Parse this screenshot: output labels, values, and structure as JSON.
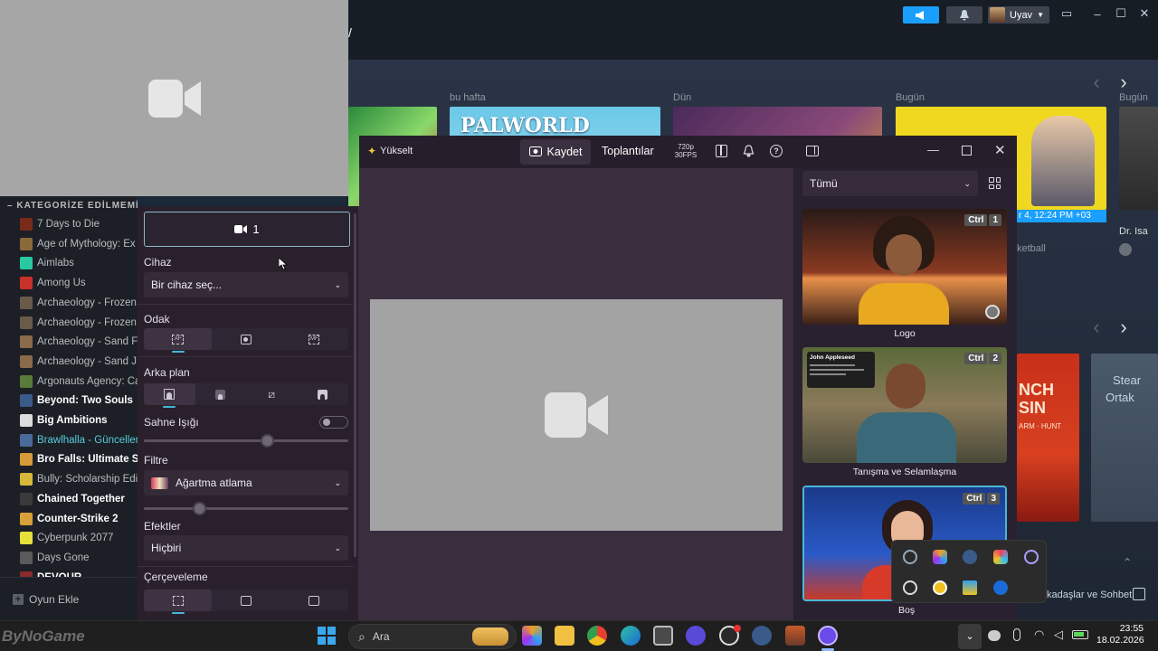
{
  "steam": {
    "announce_icon": "megaphone-icon",
    "notif_icon": "bell-icon",
    "user_name": "Uyav",
    "day_labels": [
      "bu hafta",
      "Dün",
      "Bugün",
      "Bugün"
    ],
    "card_palworld_text": "PALWORLD",
    "card_date_text": "r 4, 12:24 PM +03",
    "card_basketball_text": "ketball",
    "card_dr_text": "Dr. Isa",
    "card_punchsin_text": "NCH",
    "card_punchsin_sub": "SIN",
    "card_farm_text": "ARM · HUNT",
    "card_steam_text": "Stear",
    "card_steam_text2": "Ortak",
    "friends_chat": "kadaşlar ve Sohbet",
    "add_game": "Oyun Ekle",
    "category_title": "KATEGORİZE EDİLMEMİŞ",
    "games": [
      {
        "name": "7 Days to Die",
        "style": "normal",
        "color": "#7a2a1a"
      },
      {
        "name": "Age of Mythology: Ex",
        "style": "normal",
        "color": "#8a6a3a"
      },
      {
        "name": "Aimlabs",
        "style": "normal",
        "color": "#28c8a0"
      },
      {
        "name": "Among Us",
        "style": "normal",
        "color": "#c8302a"
      },
      {
        "name": "Archaeology - Frozen",
        "style": "normal",
        "color": "#6a5a4a"
      },
      {
        "name": "Archaeology - Frozen",
        "style": "normal",
        "color": "#6a5a4a"
      },
      {
        "name": "Archaeology - Sand F",
        "style": "normal",
        "color": "#8a6a4a"
      },
      {
        "name": "Archaeology - Sand J",
        "style": "normal",
        "color": "#8a6a4a"
      },
      {
        "name": "Argonauts Agency: Ca",
        "style": "normal",
        "color": "#5a7a3a"
      },
      {
        "name": "Beyond: Two Souls",
        "style": "bold",
        "color": "#3a5a8a"
      },
      {
        "name": "Big Ambitions",
        "style": "bold",
        "color": "#dcdcdc"
      },
      {
        "name": "Brawlhalla - Güncellen",
        "style": "update",
        "color": "#4a6a9a"
      },
      {
        "name": "Bro Falls: Ultimate Sh",
        "style": "bold",
        "color": "#d89a3a"
      },
      {
        "name": "Bully: Scholarship Edi",
        "style": "normal",
        "color": "#d8b83a"
      },
      {
        "name": "Chained Together",
        "style": "bold",
        "color": "#3a3a3a"
      },
      {
        "name": "Counter-Strike 2",
        "style": "bold",
        "color": "#d8a03a"
      },
      {
        "name": "Cyberpunk 2077",
        "style": "normal",
        "color": "#e8e03a"
      },
      {
        "name": "Days Gone",
        "style": "normal",
        "color": "#5a5a5a"
      },
      {
        "name": "DEVOUR",
        "style": "bold",
        "color": "#8a2a2a"
      }
    ]
  },
  "settings": {
    "camera_button_label": "1",
    "device_label": "Cihaz",
    "device_value": "Bir cihaz seç...",
    "focus_label": "Odak",
    "background_label": "Arka plan",
    "scene_light_label": "Sahne Işığı",
    "scene_light_level": 0.6,
    "filter_label": "Filtre",
    "filter_value": "Ağartma atlama",
    "filter_level": 0.27,
    "effects_label": "Efektler",
    "effects_value": "Hiçbiri",
    "framing_label": "Çerçeveleme"
  },
  "app": {
    "upgrade_label": "Yükselt",
    "record_label": "Kaydet",
    "meetings_label": "Toplantılar",
    "resolution": "720p",
    "fps": "30FPS",
    "scene_filter": "Tümü",
    "scenes": [
      {
        "label": "Logo",
        "ctrl": "Ctrl",
        "num": "1"
      },
      {
        "label": "Tanışma ve Selamlaşma",
        "ctrl": "Ctrl",
        "num": "2",
        "post_name": "John Appleseed"
      },
      {
        "label": "Boş",
        "ctrl": "Ctrl",
        "num": "3"
      }
    ]
  },
  "taskbar": {
    "search_placeholder": "Ara",
    "time": "23:55",
    "date": "18.02.2026"
  },
  "watermark": "ByNoGame"
}
